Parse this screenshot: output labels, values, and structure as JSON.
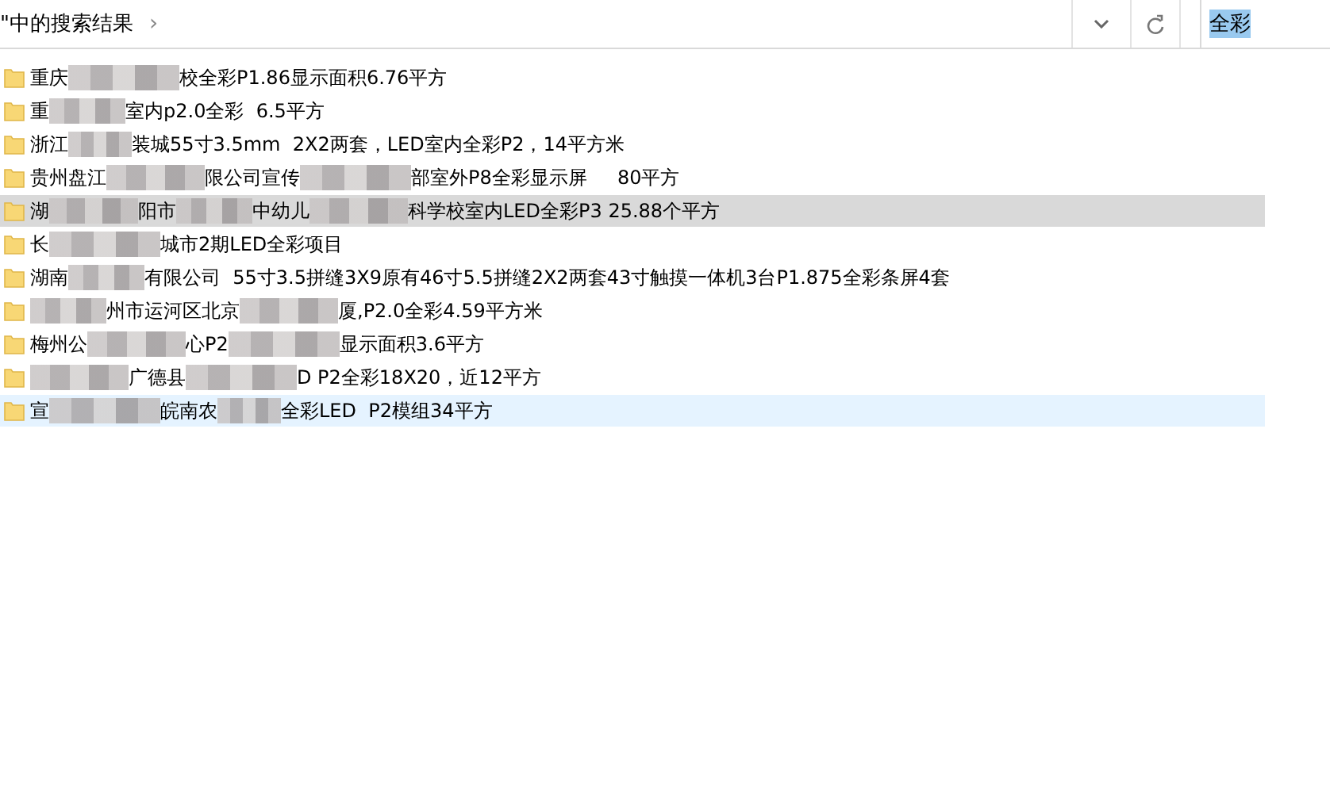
{
  "address_bar": {
    "path": "\"中的搜索结果",
    "chevron": "›"
  },
  "search": {
    "value": "全彩"
  },
  "results": [
    {
      "selected": false,
      "hovered": false,
      "segments": [
        {
          "kind": "text",
          "text": "重庆"
        },
        {
          "kind": "blur"
        },
        {
          "kind": "text",
          "text": "校全彩P1.86显示面积6.76平方"
        }
      ]
    },
    {
      "selected": false,
      "hovered": false,
      "segments": [
        {
          "kind": "text",
          "text": "重"
        },
        {
          "kind": "blur"
        },
        {
          "kind": "text",
          "text": "室内p2.0全彩  6.5平方"
        }
      ]
    },
    {
      "selected": false,
      "hovered": false,
      "segments": [
        {
          "kind": "text",
          "text": "浙江"
        },
        {
          "kind": "blur"
        },
        {
          "kind": "text",
          "text": "装城55寸3.5mm  2X2两套，LED室内全彩P2，14平方米"
        }
      ]
    },
    {
      "selected": false,
      "hovered": false,
      "segments": [
        {
          "kind": "text",
          "text": "贵州盘江"
        },
        {
          "kind": "blur"
        },
        {
          "kind": "text",
          "text": "限公司宣传"
        },
        {
          "kind": "blur"
        },
        {
          "kind": "text",
          "text": "部室外P8全彩显示屏     80平方"
        }
      ]
    },
    {
      "selected": true,
      "hovered": false,
      "segments": [
        {
          "kind": "text",
          "text": "湖"
        },
        {
          "kind": "blur"
        },
        {
          "kind": "text",
          "text": "阳市"
        },
        {
          "kind": "blur"
        },
        {
          "kind": "text",
          "text": "中幼儿"
        },
        {
          "kind": "blur"
        },
        {
          "kind": "text",
          "text": "科学校室内LED全彩P3 25.88个平方"
        }
      ]
    },
    {
      "selected": false,
      "hovered": false,
      "segments": [
        {
          "kind": "text",
          "text": "长"
        },
        {
          "kind": "blur"
        },
        {
          "kind": "text",
          "text": "城市2期LED全彩项目"
        }
      ]
    },
    {
      "selected": false,
      "hovered": false,
      "segments": [
        {
          "kind": "text",
          "text": "湖南"
        },
        {
          "kind": "blur"
        },
        {
          "kind": "text",
          "text": "有限公司  55寸3.5拼缝3X9原有46寸5.5拼缝2X2两套43寸触摸一体机3台P1.875全彩条屏4套"
        }
      ]
    },
    {
      "selected": false,
      "hovered": false,
      "segments": [
        {
          "kind": "blur"
        },
        {
          "kind": "text",
          "text": "州市运河区北京"
        },
        {
          "kind": "blur"
        },
        {
          "kind": "text",
          "text": "厦,P2.0全彩4.59平方米"
        }
      ]
    },
    {
      "selected": false,
      "hovered": false,
      "segments": [
        {
          "kind": "text",
          "text": "梅州公"
        },
        {
          "kind": "blur"
        },
        {
          "kind": "text",
          "text": "心P2"
        },
        {
          "kind": "blur"
        },
        {
          "kind": "text",
          "text": "显示面积3.6平方"
        }
      ]
    },
    {
      "selected": false,
      "hovered": false,
      "segments": [
        {
          "kind": "blur"
        },
        {
          "kind": "text",
          "text": "广德县"
        },
        {
          "kind": "blur"
        },
        {
          "kind": "text",
          "text": "D P2全彩18X20，近12平方"
        }
      ]
    },
    {
      "selected": false,
      "hovered": true,
      "segments": [
        {
          "kind": "text",
          "text": "宣"
        },
        {
          "kind": "blur"
        },
        {
          "kind": "text",
          "text": "皖南农"
        },
        {
          "kind": "blur"
        },
        {
          "kind": "text",
          "text": "全彩LED  P2模组34平方"
        }
      ]
    }
  ]
}
